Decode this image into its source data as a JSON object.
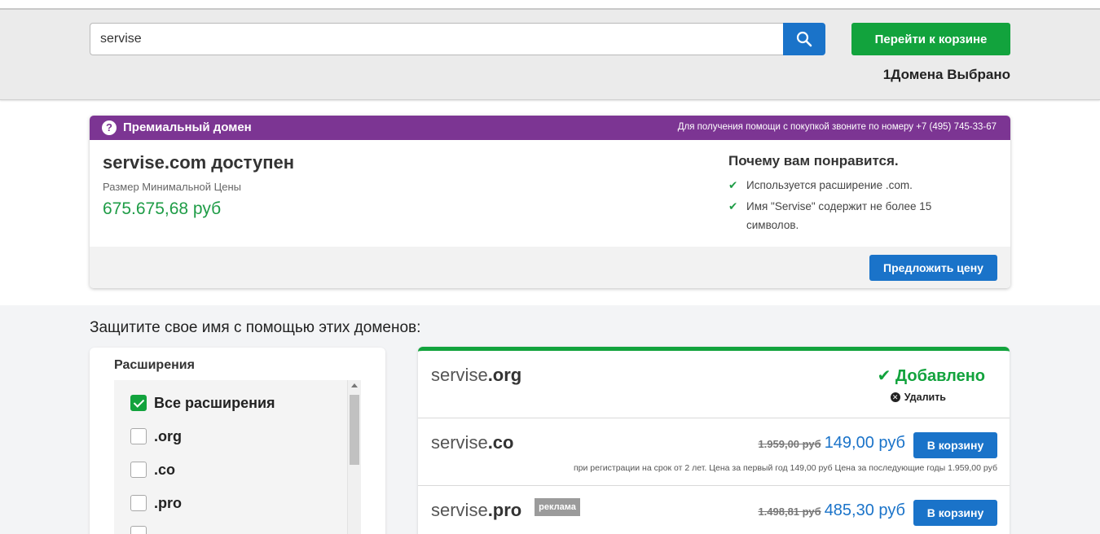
{
  "search": {
    "value": "servise",
    "button_icon": "search-icon"
  },
  "header": {
    "cart_button": "Перейти к корзине",
    "selected_count": "1Домена Выбрано"
  },
  "premium": {
    "title": "Премиальный домен",
    "help_text": "Для получения помощи с покупкой звоните по номеру +7 (495) 745-33-67",
    "icon": "question-icon",
    "domain_status": "servise.com доступен",
    "min_price_label": "Размер Минимальной Цены",
    "min_price": "675.675,68 руб",
    "why_title": "Почему вам понравится.",
    "reasons": [
      "Используется расширение .com.",
      "Имя \"Servise\" содержит не более 15 символов."
    ],
    "offer_button": "Предложить цену"
  },
  "protect": {
    "title": "Защитите свое имя с помощью этих доменов:"
  },
  "filters": {
    "title": "Расширения",
    "items": [
      {
        "label": "Все расширения",
        "checked": true
      },
      {
        "label": ".org",
        "checked": false
      },
      {
        "label": ".co",
        "checked": false
      },
      {
        "label": ".pro",
        "checked": false
      }
    ]
  },
  "results": [
    {
      "name": "servise",
      "tld": ".org",
      "added_label": "Добавлено",
      "remove_label": "Удалить"
    },
    {
      "name": "servise",
      "tld": ".co",
      "old_price": "1.959,00 руб",
      "new_price": "149,00 руб",
      "button": "В корзину",
      "terms": "при регистрации на срок от 2 лет. Цена за первый год 149,00 руб Цена за последующие годы 1.959,00 руб"
    },
    {
      "name": "servise",
      "tld": ".pro",
      "badge": "реклама",
      "old_price": "1.498,81 руб",
      "new_price": "485,30 руб",
      "button": "В корзину"
    }
  ],
  "colors": {
    "green": "#12a33d",
    "blue": "#1a73c9",
    "purple": "#7c3593"
  }
}
